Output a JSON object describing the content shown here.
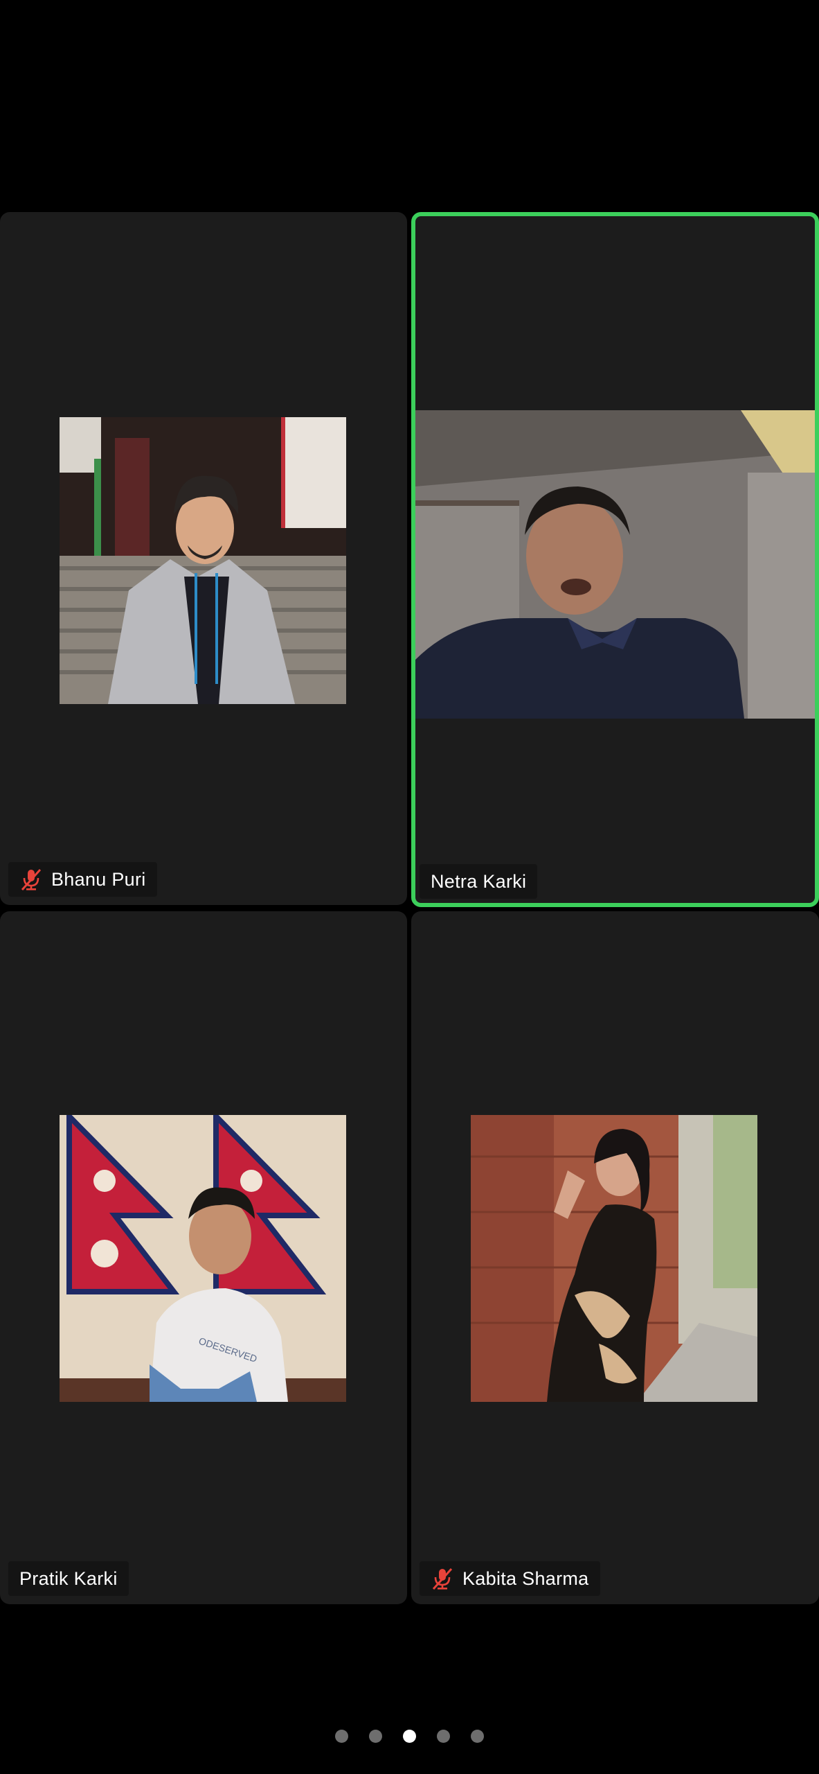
{
  "participants": [
    {
      "name": "Bhanu Puri",
      "muted": true,
      "active_speaker": false
    },
    {
      "name": "Netra Karki",
      "muted": false,
      "active_speaker": true
    },
    {
      "name": "Pratik Karki",
      "muted": false,
      "active_speaker": false
    },
    {
      "name": "Kabita Sharma",
      "muted": true,
      "active_speaker": false
    }
  ],
  "pagination": {
    "total_pages": 5,
    "current_page": 3
  },
  "colors": {
    "active_border": "#3ccf5b",
    "tile_background": "#1c1c1c",
    "mute_icon": "#e8433a",
    "page_dot": "#6e6e6e",
    "page_dot_current": "#ffffff"
  },
  "icons": {
    "muted_indicator": "microphone-off-icon"
  }
}
